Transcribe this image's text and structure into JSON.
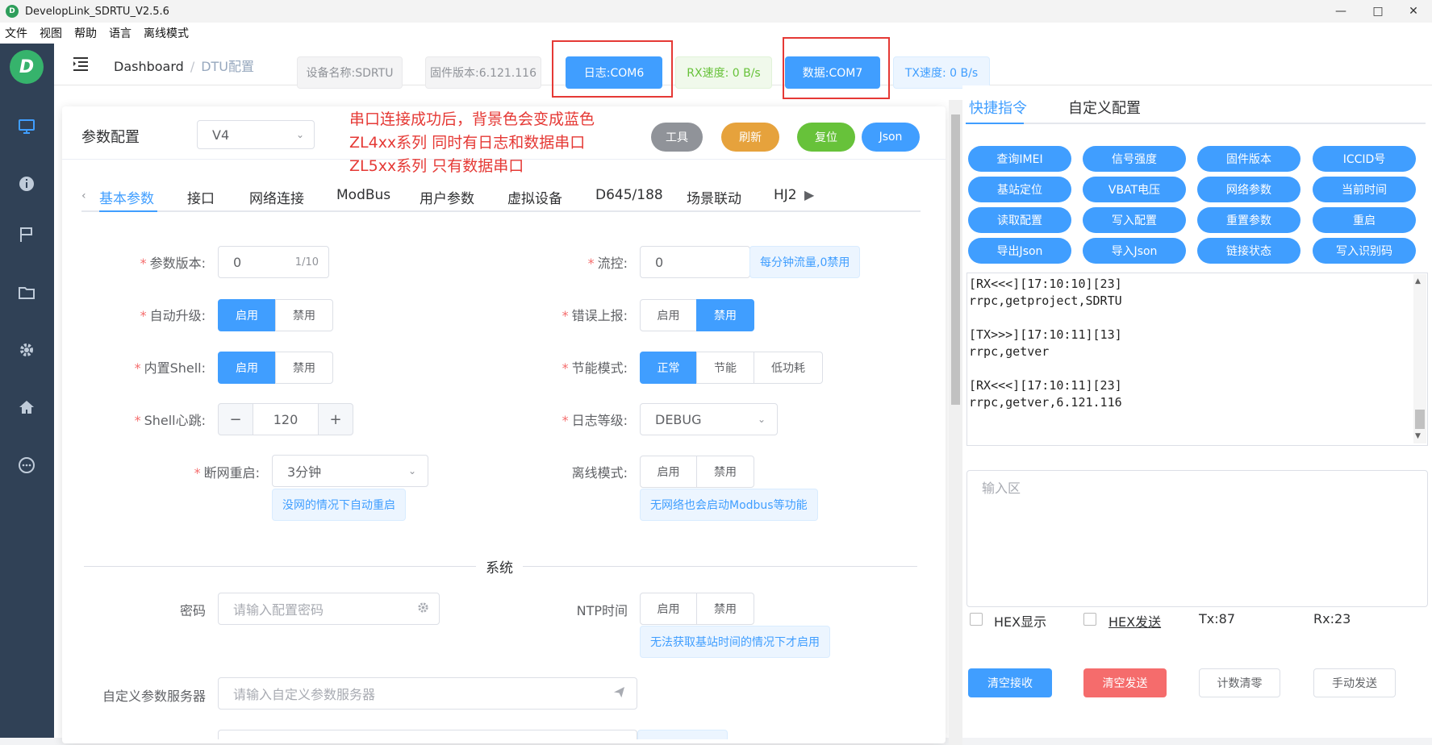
{
  "window": {
    "title": "DevelopLink_SDRTU_V2.5.6",
    "logo_letter": "D"
  },
  "menu": [
    "文件",
    "视图",
    "帮助",
    "语言",
    "离线模式"
  ],
  "sidebar": {
    "logo": "D",
    "icons": [
      "monitor-icon",
      "info-icon",
      "flag-icon",
      "folder-icon",
      "gear-icon",
      "home-icon",
      "chat-icon"
    ]
  },
  "breadcrumb": {
    "root": "Dashboard",
    "sep": "/",
    "current": "DTU配置"
  },
  "status": {
    "device": "设备名称:SDRTU",
    "firmware": "固件版本:6.121.116",
    "log_port": "日志:COM6",
    "rx": "RX速度: 0 B/s",
    "data_port": "数据:COM7",
    "tx": "TX速度: 0 B/s"
  },
  "config": {
    "title": "参数配置",
    "version_select": "V4",
    "buttons": {
      "tools": "工具",
      "refresh": "刷新",
      "reset": "复位",
      "json": "Json"
    }
  },
  "annotation": [
    "串口连接成功后，背景色会变成蓝色",
    "ZL4xx系列 同时有日志和数据串口",
    "ZL5xx系列 只有数据串口"
  ],
  "tabs": [
    "基本参数",
    "接口",
    "网络连接",
    "ModBus",
    "用户参数",
    "虚拟设备",
    "D645/188",
    "场景联动",
    "HJ2"
  ],
  "form": {
    "param_version": {
      "label": "参数版本:",
      "value": "0",
      "count": "1/10"
    },
    "flow": {
      "label": "流控:",
      "value": "0",
      "tip": "每分钟流量,0禁用"
    },
    "auto_upgrade": {
      "label": "自动升级:",
      "options": [
        "启用",
        "禁用"
      ],
      "selected": "启用"
    },
    "error_report": {
      "label": "错误上报:",
      "options": [
        "启用",
        "禁用"
      ],
      "selected": "禁用"
    },
    "shell": {
      "label": "内置Shell:",
      "options": [
        "启用",
        "禁用"
      ],
      "selected": "启用"
    },
    "power_mode": {
      "label": "节能模式:",
      "options": [
        "正常",
        "节能",
        "低功耗"
      ],
      "selected": "正常"
    },
    "heartbeat": {
      "label": "Shell心跳:",
      "value": "120",
      "minus": "−",
      "plus": "+"
    },
    "log_level": {
      "label": "日志等级:",
      "value": "DEBUG"
    },
    "net_restart": {
      "label": "断网重启:",
      "value": "3分钟",
      "tip": "没网的情况下自动重启"
    },
    "offline": {
      "label": "离线模式:",
      "options": [
        "启用",
        "禁用"
      ],
      "tip": "无网络也会启动Modbus等功能"
    },
    "section": "系统",
    "password": {
      "label": "密码",
      "placeholder": "请输入配置密码"
    },
    "ntp": {
      "label": "NTP时间",
      "options": [
        "启用",
        "禁用"
      ],
      "tip": "无法获取基站时间的情况下才启用"
    },
    "custom_server": {
      "label": "自定义参数服务器",
      "placeholder": "请输入自定义参数服务器"
    }
  },
  "right": {
    "tabs": [
      "快捷指令",
      "自定义配置"
    ],
    "quick": [
      "查询IMEI",
      "信号强度",
      "固件版本",
      "ICCID号",
      "基站定位",
      "VBAT电压",
      "网络参数",
      "当前时间",
      "读取配置",
      "写入配置",
      "重置参数",
      "重启",
      "导出Json",
      "导入Json",
      "链接状态",
      "写入识别码"
    ],
    "log": "[RX<<<][17:10:10][23]\nrrpc,getproject,SDRTU\n\n[TX>>>][17:10:11][13]\nrrpc,getver\n\n[RX<<<][17:10:11][23]\nrrpc,getver,6.121.116",
    "input_placeholder": "输入区",
    "hex_show": "HEX显示",
    "hex_send": "HEX发送",
    "tx": "Tx:87",
    "rx": "Rx:23",
    "buttons": {
      "clear_rx": "清空接收",
      "clear_tx": "清空发送",
      "reset_count": "计数清零",
      "manual_send": "手动发送"
    }
  },
  "colors": {
    "primary": "#409eff",
    "sidebar": "#304156",
    "danger": "#f56c6c",
    "success": "#67c23a",
    "warning": "#e6a23c",
    "annotation": "#e53935"
  }
}
